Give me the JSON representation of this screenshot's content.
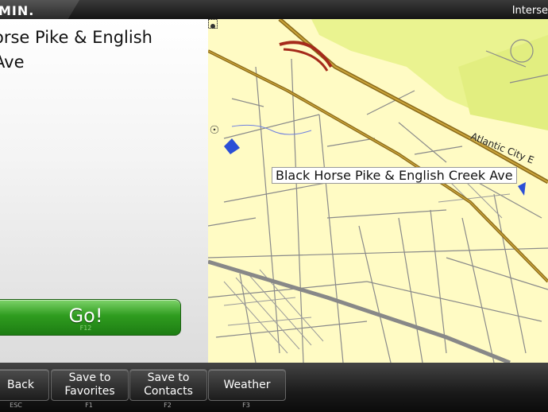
{
  "topbar": {
    "logo": "MIN.",
    "title": "Interse"
  },
  "location": {
    "line1": "orse Pike & English",
    "line2": "Ave"
  },
  "go_button": {
    "label": "Go!",
    "key": "F12"
  },
  "map": {
    "location_label": "Black Horse Pike & English Creek Ave",
    "road_label": "Atlantic City E"
  },
  "softkeys": [
    {
      "label_lines": [
        "Back"
      ],
      "key": "ESC"
    },
    {
      "label_lines": [
        "Save to",
        "Favorites"
      ],
      "key": "F1"
    },
    {
      "label_lines": [
        "Save to",
        "Contacts"
      ],
      "key": "F2"
    },
    {
      "label_lines": [
        "Weather"
      ],
      "key": "F3"
    }
  ],
  "icons": [
    "compass-icon",
    "zoom-icon"
  ],
  "colors": {
    "map_bg": "#fffbc4",
    "park": "#eaf390",
    "highway": "#8a6a1a",
    "interchange": "#a52a1a",
    "go_green": "#2f9c1f"
  }
}
